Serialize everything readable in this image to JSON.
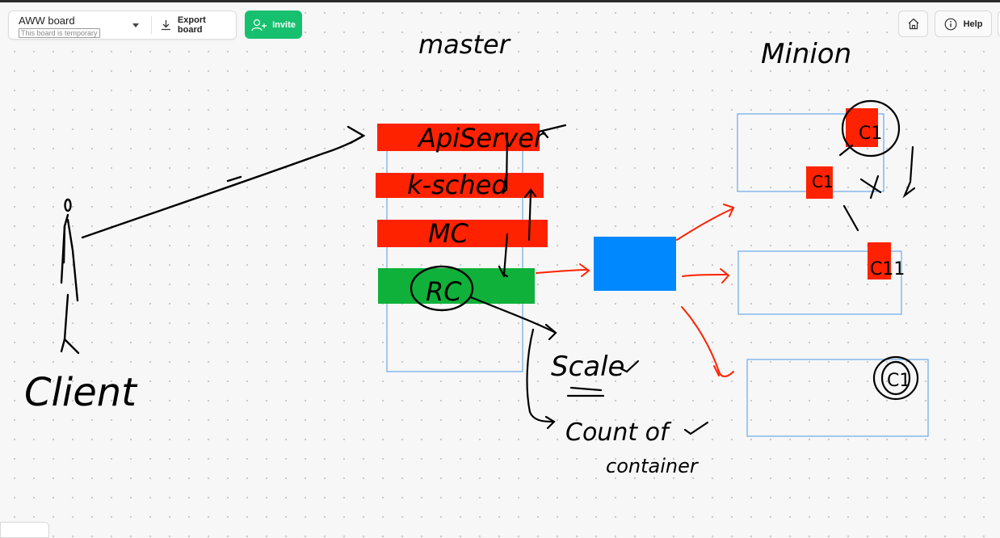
{
  "toolbar": {
    "board_name": "AWW board",
    "board_subtitle": "This board is temporary",
    "export_label": "Export board",
    "invite_label": "Invite",
    "help_label": "Help",
    "accent_color": "#17c06e"
  },
  "icons": {
    "dropdown": "chevron-down-icon",
    "export": "download-icon",
    "invite": "add-user-icon",
    "home": "home-icon",
    "help": "info-icon"
  },
  "whiteboard": {
    "client_label": "Client",
    "master_label": "master",
    "minion_label": "Minion",
    "api_label": "ApiServer",
    "ksched_label": "k-sched",
    "mc_label": "MC",
    "rc_label": "RC",
    "scale_label": "Scale",
    "count_label": "Count of",
    "container_label": "container",
    "c1_labels": [
      "C1",
      "C1",
      "C11",
      "C1"
    ],
    "colors": {
      "red": "#ff2200",
      "green": "#10b13a",
      "blue": "#0088ff",
      "box_border": "#6aa9e8"
    }
  }
}
